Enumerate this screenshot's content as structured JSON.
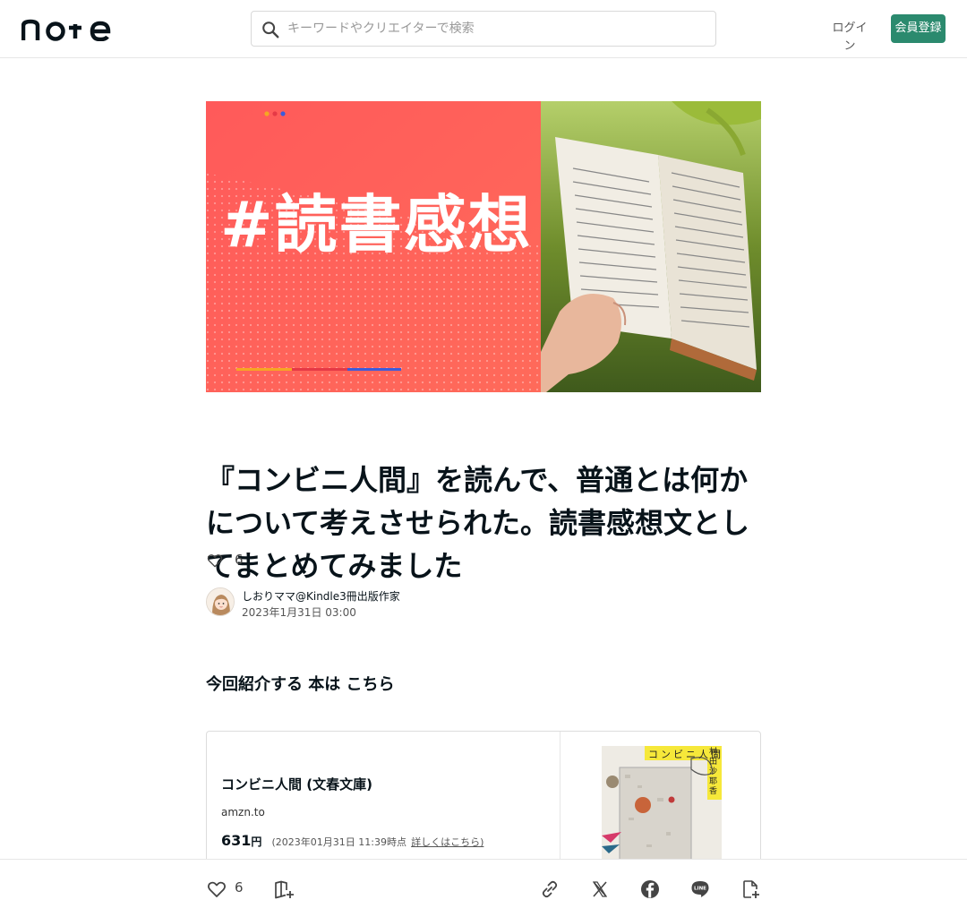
{
  "header": {
    "logo_text": "note",
    "search": {
      "placeholder": "キーワードやクリエイターで検索"
    },
    "login_label": "ログイン",
    "signup_label": "会員登録"
  },
  "hero": {
    "tag_text": "#読書感想",
    "colors": {
      "background": "#ff5a5a",
      "dots": [
        "#f5a623",
        "#e63946",
        "#3b5bdb"
      ]
    }
  },
  "article": {
    "title": "『コンビニ人間』を読んで、普通とは何かについて考えさせられた。読書感想文としてまとめてみました",
    "likes": "6",
    "author_name": "しおりママ@Kindle3冊出版作家",
    "date": "2023年1月31日 03:00",
    "lead": "今回紹介する 本は こちら"
  },
  "embed": {
    "title": "コンビニ人間 (文春文庫)",
    "domain": "amzn.to",
    "price": "631",
    "price_unit": "円",
    "price_note": "(2023年01月31日 11:39時点",
    "price_link": "詳しくはこちら)",
    "cover_title": "コンビニ人間",
    "cover_author": [
      "村",
      "田",
      "沙",
      "耶",
      "香"
    ]
  },
  "bottombar": {
    "likes": "6"
  },
  "colors": {
    "accent": "#2b8a6e",
    "text": "#08131a"
  }
}
